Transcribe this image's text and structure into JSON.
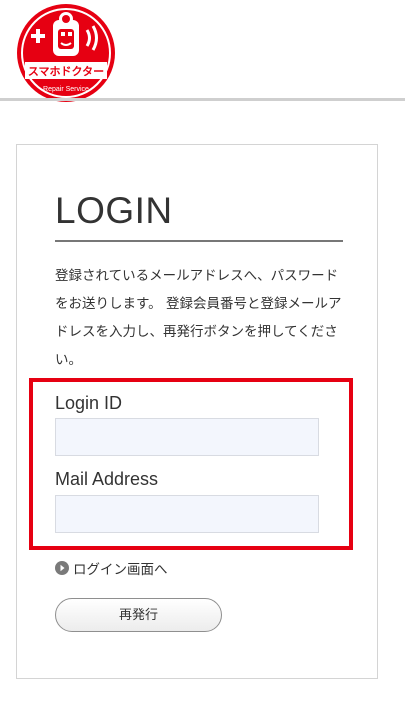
{
  "header": {
    "logo": {
      "name": "スマホドクター",
      "subtitle": "Repair Service"
    }
  },
  "login": {
    "title": "LOGIN",
    "description": "登録されているメールアドレスへ、パスワードをお送りします。 登録会員番号と登録メールアドレスを入力し、再発行ボタンを押してください。",
    "fields": {
      "login_id": {
        "label": "Login ID",
        "value": "",
        "placeholder": ""
      },
      "mail_address": {
        "label": "Mail Address",
        "value": "",
        "placeholder": ""
      }
    },
    "back_link": "ログイン画面へ",
    "submit_label": "再発行"
  },
  "colors": {
    "brand_red": "#e60012",
    "input_bg": "#f3f6fd",
    "text": "#333333"
  },
  "icons": [
    "smartphone-doctor-logo",
    "circle-arrow-right-icon"
  ]
}
